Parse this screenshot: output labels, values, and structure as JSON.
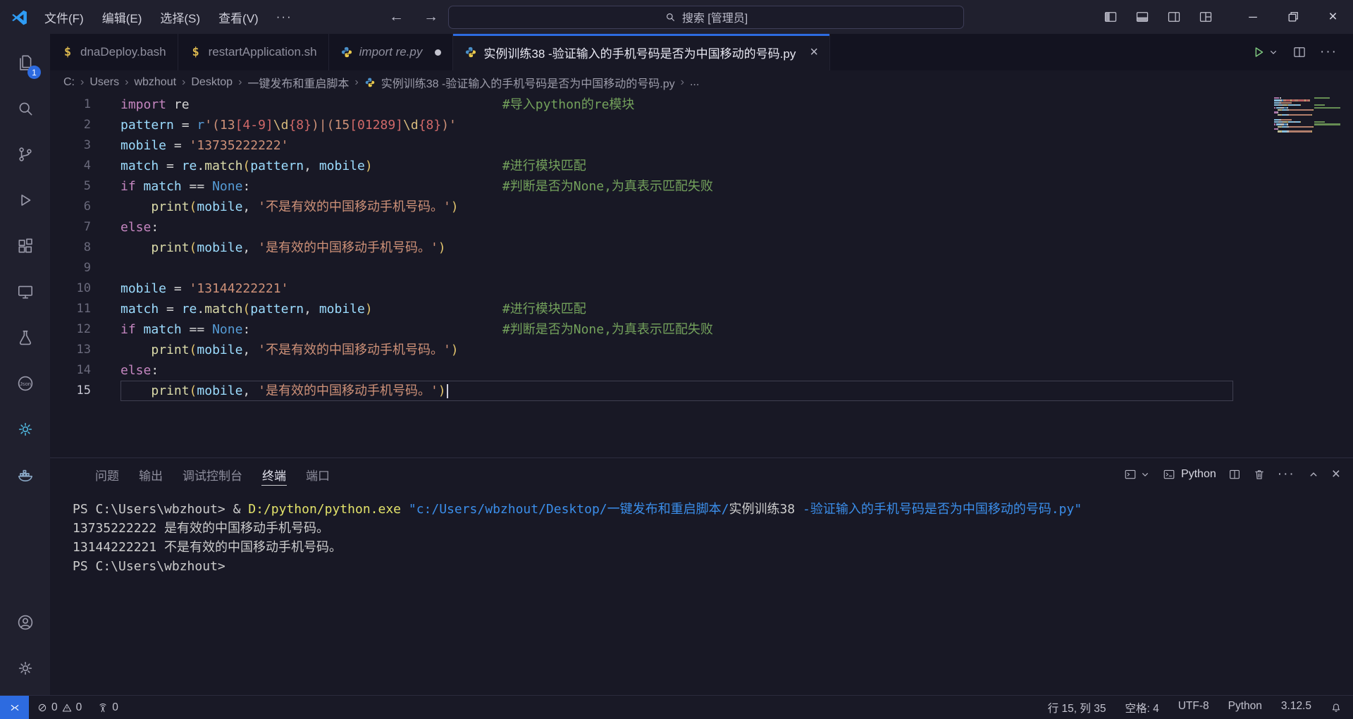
{
  "title_bar": {
    "menus": [
      {
        "name": "menu-file",
        "label": "文件(F)"
      },
      {
        "name": "menu-edit",
        "label": "编辑(E)"
      },
      {
        "name": "menu-selection",
        "label": "选择(S)"
      },
      {
        "name": "menu-view",
        "label": "查看(V)"
      }
    ],
    "more_label": "···",
    "nav_back": "←",
    "nav_forward": "→",
    "search_text": "搜索 [管理员]"
  },
  "activity_bar": {
    "top_items": [
      {
        "name": "explorer",
        "icon": "files-icon",
        "badge": "1"
      },
      {
        "name": "search",
        "icon": "search-icon"
      },
      {
        "name": "source-control",
        "icon": "source-control-icon"
      },
      {
        "name": "run-debug",
        "icon": "run-debug-icon"
      },
      {
        "name": "extensions",
        "icon": "extensions-icon"
      },
      {
        "name": "remote-explorer",
        "icon": "remote-explorer-icon"
      },
      {
        "name": "testing",
        "icon": "testing-icon"
      },
      {
        "name": "json",
        "icon": "json-icon"
      },
      {
        "name": "gear-extension",
        "icon": "gear-circle-icon",
        "tint": "teal"
      },
      {
        "name": "docker",
        "icon": "docker-icon",
        "tint": "steel"
      }
    ],
    "bottom_items": [
      {
        "name": "accounts",
        "icon": "accounts-icon"
      },
      {
        "name": "settings",
        "icon": "settings-icon"
      }
    ]
  },
  "tabs": [
    {
      "label": "dnaDeploy.bash",
      "icon": "shell",
      "active": false,
      "modified": false,
      "italic": false
    },
    {
      "label": "restartApplication.sh",
      "icon": "shell",
      "active": false,
      "modified": false,
      "italic": false
    },
    {
      "label": "import re.py",
      "icon": "python",
      "active": false,
      "modified": true,
      "italic": true
    },
    {
      "label": "实例训练38 -验证输入的手机号码是否为中国移动的号码.py",
      "icon": "python",
      "active": true,
      "modified": false,
      "italic": false,
      "close_label": "×"
    }
  ],
  "breadcrumb": {
    "segments": [
      "C:",
      "Users",
      "wbzhout",
      "Desktop",
      "一键发布和重启脚本"
    ],
    "file": "实例训练38 -验证输入的手机号码是否为中国移动的号码.py",
    "tail": "..."
  },
  "editor": {
    "cursor_line": 15,
    "token_colors": {
      "kw": "#C586C0",
      "var": "#9CDCFE",
      "fn": "#DCDCAA",
      "def": "#D4D4D4",
      "str": "#CE9178",
      "esc": "#D7BA7D",
      "cls": "#D16969",
      "blue": "#569CD6",
      "cmt": "#74A25C",
      "brk": "#E2C46D"
    },
    "lines": [
      {
        "n": 1,
        "tokens": [
          [
            "import",
            "kw"
          ],
          [
            " ",
            "def"
          ],
          [
            "re",
            "def"
          ],
          [
            " ",
            "def",
            41
          ],
          [
            "#导入python的re模块",
            "cmt"
          ]
        ]
      },
      {
        "n": 2,
        "tokens": [
          [
            "pattern",
            "var"
          ],
          [
            " = ",
            "def"
          ],
          [
            "r",
            "blue"
          ],
          [
            "'(13",
            "str"
          ],
          [
            "[4-9]",
            "cls"
          ],
          [
            "\\d",
            "esc"
          ],
          [
            "{8}",
            "cls"
          ],
          [
            ")|(15",
            "str"
          ],
          [
            "[01289]",
            "cls"
          ],
          [
            "\\d",
            "esc"
          ],
          [
            "{8}",
            "cls"
          ],
          [
            ")'",
            "str"
          ]
        ]
      },
      {
        "n": 3,
        "tokens": [
          [
            "mobile",
            "var"
          ],
          [
            " = ",
            "def"
          ],
          [
            "'13735222222'",
            "str"
          ]
        ]
      },
      {
        "n": 4,
        "tokens": [
          [
            "match",
            "var"
          ],
          [
            " = ",
            "def"
          ],
          [
            "re",
            "var"
          ],
          [
            ".",
            "def"
          ],
          [
            "match",
            "fn"
          ],
          [
            "(",
            "brk"
          ],
          [
            "pattern",
            "var"
          ],
          [
            ", ",
            "def"
          ],
          [
            "mobile",
            "var"
          ],
          [
            ")",
            "brk"
          ],
          [
            " ",
            "def",
            17
          ],
          [
            "#进行模块匹配",
            "cmt"
          ]
        ]
      },
      {
        "n": 5,
        "tokens": [
          [
            "if",
            "kw"
          ],
          [
            " ",
            "def"
          ],
          [
            "match",
            "var"
          ],
          [
            " == ",
            "def"
          ],
          [
            "None",
            "blue"
          ],
          [
            ":",
            "def"
          ],
          [
            " ",
            "def",
            33
          ],
          [
            "#判断是否为None,为真表示匹配失败",
            "cmt"
          ]
        ]
      },
      {
        "n": 6,
        "tokens": [
          [
            " ",
            "def",
            4
          ],
          [
            "print",
            "fn"
          ],
          [
            "(",
            "brk"
          ],
          [
            "mobile",
            "var"
          ],
          [
            ", ",
            "def"
          ],
          [
            "'不是有效的中国移动手机号码。'",
            "str"
          ],
          [
            ")",
            "brk"
          ]
        ]
      },
      {
        "n": 7,
        "tokens": [
          [
            "else",
            "kw"
          ],
          [
            ":",
            "def"
          ]
        ]
      },
      {
        "n": 8,
        "tokens": [
          [
            " ",
            "def",
            4
          ],
          [
            "print",
            "fn"
          ],
          [
            "(",
            "brk"
          ],
          [
            "mobile",
            "var"
          ],
          [
            ", ",
            "def"
          ],
          [
            "'是有效的中国移动手机号码。'",
            "str"
          ],
          [
            ")",
            "brk"
          ]
        ]
      },
      {
        "n": 9,
        "tokens": []
      },
      {
        "n": 10,
        "tokens": [
          [
            "mobile",
            "var"
          ],
          [
            " = ",
            "def"
          ],
          [
            "'13144222221'",
            "str"
          ]
        ]
      },
      {
        "n": 11,
        "tokens": [
          [
            "match",
            "var"
          ],
          [
            " = ",
            "def"
          ],
          [
            "re",
            "var"
          ],
          [
            ".",
            "def"
          ],
          [
            "match",
            "fn"
          ],
          [
            "(",
            "brk"
          ],
          [
            "pattern",
            "var"
          ],
          [
            ", ",
            "def"
          ],
          [
            "mobile",
            "var"
          ],
          [
            ")",
            "brk"
          ],
          [
            " ",
            "def",
            17
          ],
          [
            "#进行模块匹配",
            "cmt"
          ]
        ]
      },
      {
        "n": 12,
        "tokens": [
          [
            "if",
            "kw"
          ],
          [
            " ",
            "def"
          ],
          [
            "match",
            "var"
          ],
          [
            " == ",
            "def"
          ],
          [
            "None",
            "blue"
          ],
          [
            ":",
            "def"
          ],
          [
            " ",
            "def",
            33
          ],
          [
            "#判断是否为None,为真表示匹配失败",
            "cmt"
          ]
        ]
      },
      {
        "n": 13,
        "tokens": [
          [
            " ",
            "def",
            4
          ],
          [
            "print",
            "fn"
          ],
          [
            "(",
            "brk"
          ],
          [
            "mobile",
            "var"
          ],
          [
            ", ",
            "def"
          ],
          [
            "'不是有效的中国移动手机号码。'",
            "str"
          ],
          [
            ")",
            "brk"
          ]
        ]
      },
      {
        "n": 14,
        "tokens": [
          [
            "else",
            "kw"
          ],
          [
            ":",
            "def"
          ]
        ]
      },
      {
        "n": 15,
        "tokens": [
          [
            " ",
            "def",
            4
          ],
          [
            "print",
            "fn"
          ],
          [
            "(",
            "brk"
          ],
          [
            "mobile",
            "var"
          ],
          [
            ", ",
            "def"
          ],
          [
            "'是有效的中国移动手机号码。'",
            "str"
          ],
          [
            ")",
            "brk"
          ]
        ]
      }
    ]
  },
  "panel": {
    "tabs": [
      {
        "name": "problems",
        "label": "问题",
        "active": false
      },
      {
        "name": "output",
        "label": "输出",
        "active": false
      },
      {
        "name": "debug-console",
        "label": "调试控制台",
        "active": false
      },
      {
        "name": "terminal",
        "label": "终端",
        "active": true
      },
      {
        "name": "ports",
        "label": "端口",
        "active": false
      }
    ],
    "profile_label": "Python",
    "terminal": {
      "colors": {
        "tdef": "#cccccc",
        "tcmd": "#e2e26a",
        "tstr": "#3b8eea"
      },
      "lines": [
        [
          [
            "PS C:\\Users\\wbzhout> ",
            "tdef"
          ],
          [
            "& ",
            "tdef"
          ],
          [
            "D:/python/python.exe",
            "tcmd"
          ],
          [
            " ",
            "tdef"
          ],
          [
            "\"c:/Users/wbzhout/Desktop/一键发布和重启脚本/",
            "tstr"
          ],
          [
            "实例训练38",
            "tdef"
          ],
          [
            " -验证输入的手机号码是否为中国移动的号码.py\"",
            "tstr"
          ]
        ],
        [
          [
            "13735222222 是有效的中国移动手机号码。",
            "tdef"
          ]
        ],
        [
          [
            "13144222221 不是有效的中国移动手机号码。",
            "tdef"
          ]
        ],
        [
          [
            "PS C:\\Users\\wbzhout>",
            "tdef"
          ]
        ]
      ]
    }
  },
  "status_bar": {
    "problems": {
      "errors": "0",
      "warnings": "0"
    },
    "ports": "0",
    "right_items": [
      {
        "name": "cursor-position",
        "label": "行 15, 列 35"
      },
      {
        "name": "indentation",
        "label": "空格: 4"
      },
      {
        "name": "encoding",
        "label": "UTF-8"
      },
      {
        "name": "language-mode",
        "label": "Python"
      },
      {
        "name": "python-version",
        "label": "3.12.5"
      }
    ]
  }
}
